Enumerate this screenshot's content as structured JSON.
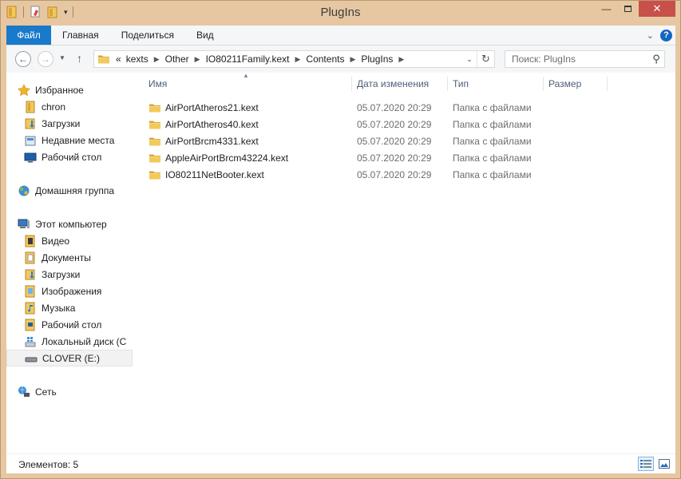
{
  "window": {
    "title": "PlugIns"
  },
  "ribbon": {
    "tabs": [
      "Файл",
      "Главная",
      "Поделиться",
      "Вид"
    ],
    "help_label": "?"
  },
  "address": {
    "overflow": "«",
    "crumbs": [
      "kexts",
      "Other",
      "IO80211Family.kext",
      "Contents",
      "PlugIns"
    ]
  },
  "search": {
    "placeholder": "Поиск: PlugIns"
  },
  "nav": {
    "favorites": {
      "label": "Избранное",
      "items": [
        "chron",
        "Загрузки",
        "Недавние места",
        "Рабочий стол"
      ]
    },
    "homegroup": {
      "label": "Домашняя группа"
    },
    "computer": {
      "label": "Этот компьютер",
      "items": [
        "Видео",
        "Документы",
        "Загрузки",
        "Изображения",
        "Музыка",
        "Рабочий стол",
        "Локальный диск (C",
        "CLOVER (E:)"
      ]
    },
    "network": {
      "label": "Сеть"
    }
  },
  "columns": {
    "name": "Имя",
    "date": "Дата изменения",
    "type": "Тип",
    "size": "Размер"
  },
  "files": [
    {
      "name": "AirPortAtheros21.kext",
      "date": "05.07.2020 20:29",
      "type": "Папка с файлами"
    },
    {
      "name": "AirPortAtheros40.kext",
      "date": "05.07.2020 20:29",
      "type": "Папка с файлами"
    },
    {
      "name": "AirPortBrcm4331.kext",
      "date": "05.07.2020 20:29",
      "type": "Папка с файлами"
    },
    {
      "name": "AppleAirPortBrcm43224.kext",
      "date": "05.07.2020 20:29",
      "type": "Папка с файлами"
    },
    {
      "name": "IO80211NetBooter.kext",
      "date": "05.07.2020 20:29",
      "type": "Папка с файлами"
    }
  ],
  "status": {
    "text": "Элементов: 5"
  },
  "colors": {
    "accent": "#1979ca",
    "frame": "#e6c7a1",
    "folder": "#e8b84a",
    "close": "#c7504b"
  }
}
